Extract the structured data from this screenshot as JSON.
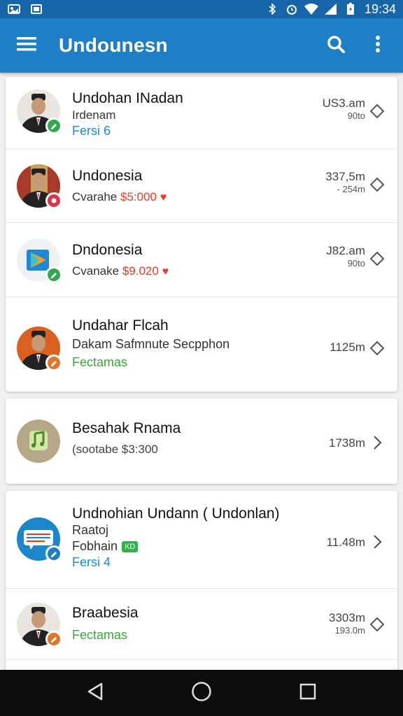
{
  "status_bar": {
    "time": "19:34",
    "icons": [
      "photo-icon",
      "image-icon",
      "bluetooth-icon",
      "alarm-icon",
      "wifi-icon",
      "signal-icon",
      "battery-icon"
    ]
  },
  "app_bar": {
    "title": "Undounesn",
    "menu_icon": "menu-icon",
    "actions": [
      "search-icon",
      "more-vert-icon"
    ],
    "color": "#1e7ec6"
  },
  "groups": [
    {
      "items": [
        {
          "title": "Undohan INadan",
          "line2": "Irdenam",
          "line3": "Fersi 6",
          "line3_color": "blue",
          "time": "US3.am",
          "time2": "90to",
          "badge_color": "#2fa84f"
        },
        {
          "title": "Undonesia",
          "line2": "Cvarahe",
          "price": "$5:000",
          "time": "337,5m",
          "time2": "- 254m",
          "badge_color": "#d8364a"
        },
        {
          "title": "Dndonesia",
          "line2": "Cvanake",
          "price": "$9.020",
          "time": "J82.am",
          "time2": "90to",
          "badge_color": "#2fa84f"
        },
        {
          "title": "Undahar Flcah",
          "line2": "Dakam Safmnute Secpphon",
          "line3": "Fectamas",
          "line3_color": "green",
          "time": "1125m",
          "badge_color": "#e2742b"
        }
      ]
    },
    {
      "items": [
        {
          "title": "Besahak Rnama",
          "line2": "(sootabe $3:300",
          "time": "1738m"
        }
      ]
    },
    {
      "items": [
        {
          "title": "Undnohian Undann ( Undonlan)",
          "line2": "Raatoj",
          "line3": "Fobhain",
          "tag": "KD",
          "line4": "Fersi 4",
          "time": "11.48m",
          "badge_color": "#1e7ec6"
        },
        {
          "title": "Braabesia",
          "line3": "Fectamas",
          "line3_color": "green",
          "time": "3303m",
          "time2": "193.0m",
          "badge_color": "#e2742b"
        }
      ]
    }
  ],
  "nav_bar": {
    "buttons": [
      "back-icon",
      "home-icon",
      "recents-icon"
    ]
  }
}
